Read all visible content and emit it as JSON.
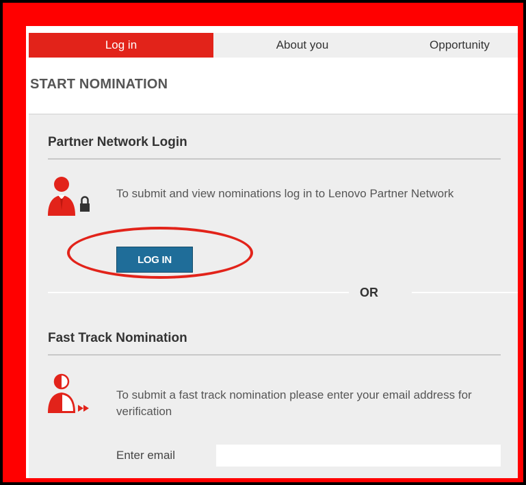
{
  "steps": [
    {
      "label": "Log in",
      "active": true
    },
    {
      "label": "About you",
      "active": false
    },
    {
      "label": "Opportunity",
      "active": false
    }
  ],
  "page_title": "START NOMINATION",
  "partner": {
    "heading": "Partner Network Login",
    "icon": "user-lock-icon",
    "description": "To submit and view nominations log in to Lenovo Partner Network",
    "button_label": "LOG IN"
  },
  "separator_label": "OR",
  "fasttrack": {
    "heading": "Fast Track Nomination",
    "icon": "user-fast-forward-icon",
    "description": "To submit a fast track nomination please enter your email address for verification",
    "email_label": "Enter email",
    "email_value": ""
  },
  "colors": {
    "brand_red": "#e2231a",
    "button_blue": "#1f6d99",
    "panel_gray": "#eeeeee",
    "highlight_red": "#ff0000"
  }
}
